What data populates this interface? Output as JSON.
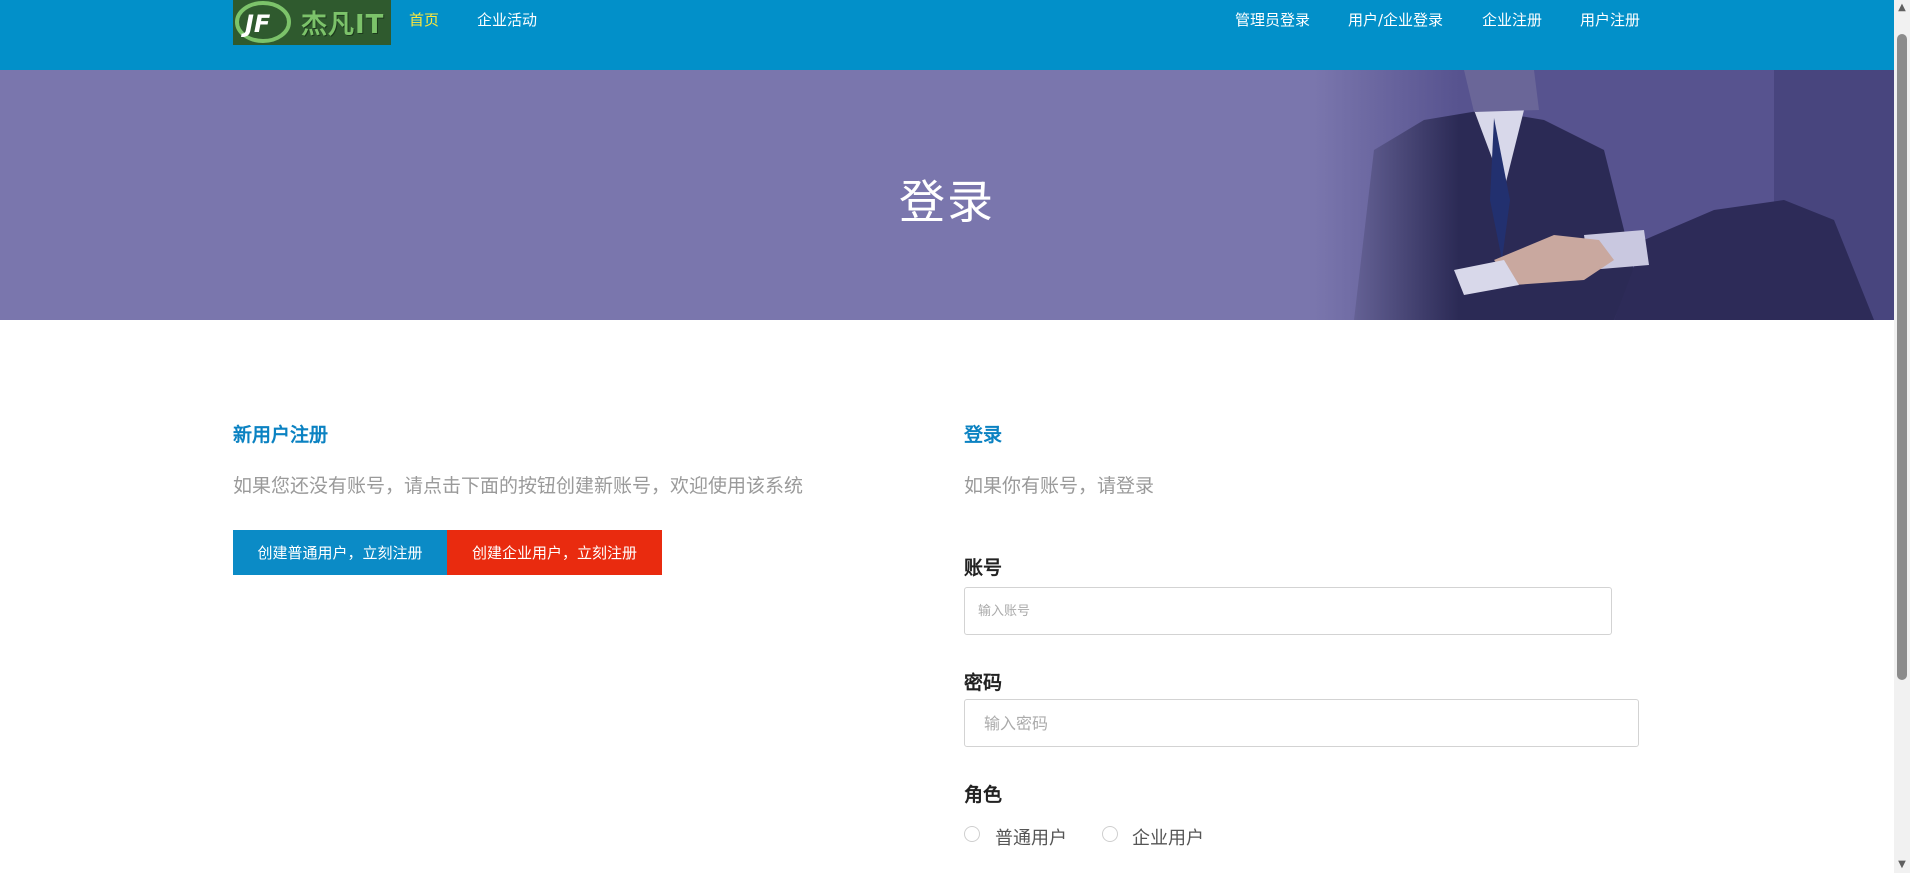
{
  "nav": {
    "logo_text": "杰凡IT",
    "home": "首页",
    "activities": "企业活动",
    "admin_login": "管理员登录",
    "user_company_login": "用户/企业登录",
    "company_register": "企业注册",
    "user_register": "用户注册"
  },
  "hero": {
    "title": "登录"
  },
  "register": {
    "title": "新用户注册",
    "desc": "如果您还没有账号，请点击下面的按钮创建新账号，欢迎使用该系统",
    "btn_user": "创建普通用户，立刻注册",
    "btn_company": "创建企业用户，立刻注册"
  },
  "login": {
    "title": "登录",
    "desc": "如果你有账号，请登录",
    "account_label": "账号",
    "account_placeholder": "输入账号",
    "password_label": "密码",
    "password_placeholder": "输入密码",
    "role_label": "角色",
    "role_user": "普通用户",
    "role_company": "企业用户"
  },
  "colors": {
    "nav_bg": "#0290c9",
    "hero_bg": "#7a76ad",
    "accent_blue": "#0b8bc6",
    "accent_red": "#e92b0f",
    "active_nav": "#ffe83a"
  }
}
